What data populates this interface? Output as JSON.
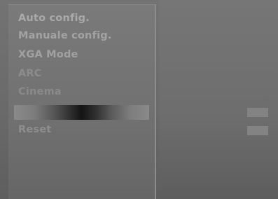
{
  "menu": {
    "items": [
      {
        "label": "Auto config."
      },
      {
        "label": "Manuale config."
      },
      {
        "label": "XGA Mode"
      },
      {
        "label": "ARC"
      },
      {
        "label": "Cinema"
      },
      {
        "label": ""
      },
      {
        "label": "Reset"
      }
    ],
    "selected_index": 5
  },
  "colors": {
    "background": "#6f6f6f",
    "panel": "#737373",
    "text_active": "#a9a9a9",
    "text_dim": "#8a8a8a",
    "selection_center": "#141414"
  }
}
